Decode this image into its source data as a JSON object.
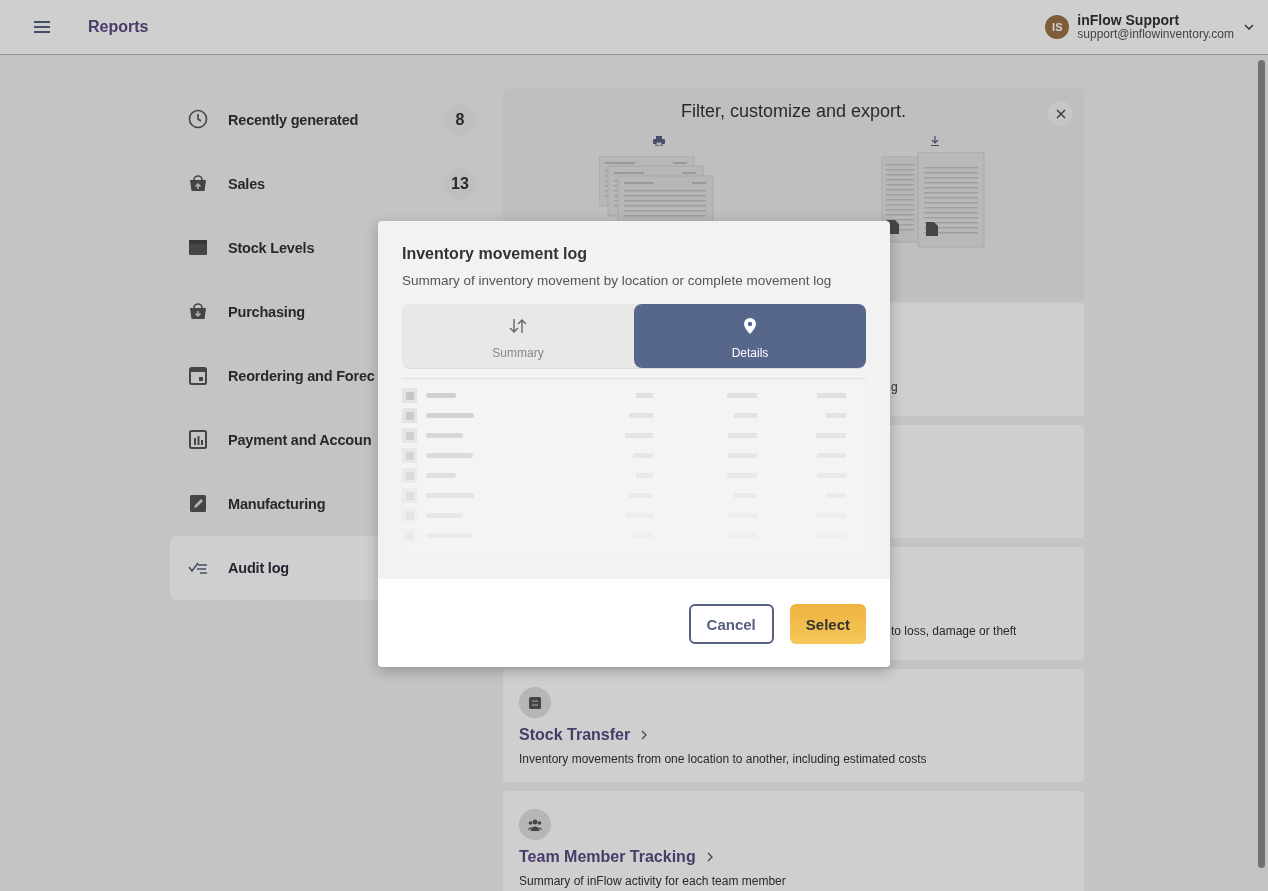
{
  "header": {
    "title": "Reports",
    "user": {
      "initials": "IS",
      "name": "inFlow Support",
      "email": "support@inflowinventory.com"
    }
  },
  "sidebar": {
    "items": [
      {
        "label": "Recently generated",
        "count": "8",
        "selected": false
      },
      {
        "label": "Sales",
        "count": "13",
        "selected": false
      },
      {
        "label": "Stock Levels",
        "selected": false
      },
      {
        "label": "Purchasing",
        "selected": false
      },
      {
        "label": "Reordering and Forec",
        "selected": false
      },
      {
        "label": "Payment and Accoun",
        "selected": false
      },
      {
        "label": "Manufacturing",
        "selected": false
      },
      {
        "label": "Audit log",
        "selected": true
      }
    ]
  },
  "banner": {
    "title": "Filter, customize and export."
  },
  "cards": [
    {
      "kind": "covered",
      "description": "g"
    },
    {
      "kind": "covered"
    },
    {
      "kind": "covered",
      "description": "to loss, damage or theft"
    },
    {
      "kind": "report",
      "title": "Stock Transfer",
      "description": "Inventory movements from one location to another, including estimated costs"
    },
    {
      "kind": "report",
      "title": "Team Member Tracking",
      "description": "Summary of inFlow activity for each team member"
    }
  ],
  "modal": {
    "title": "Inventory movement log",
    "subtitle": "Summary of inventory movement by location or complete movement log",
    "options": [
      {
        "label": "Summary",
        "selected": false
      },
      {
        "label": "Details",
        "selected": true
      }
    ],
    "buttons": [
      {
        "label": "Cancel",
        "kind": "secondary"
      },
      {
        "label": "Select",
        "kind": "primary"
      }
    ]
  }
}
